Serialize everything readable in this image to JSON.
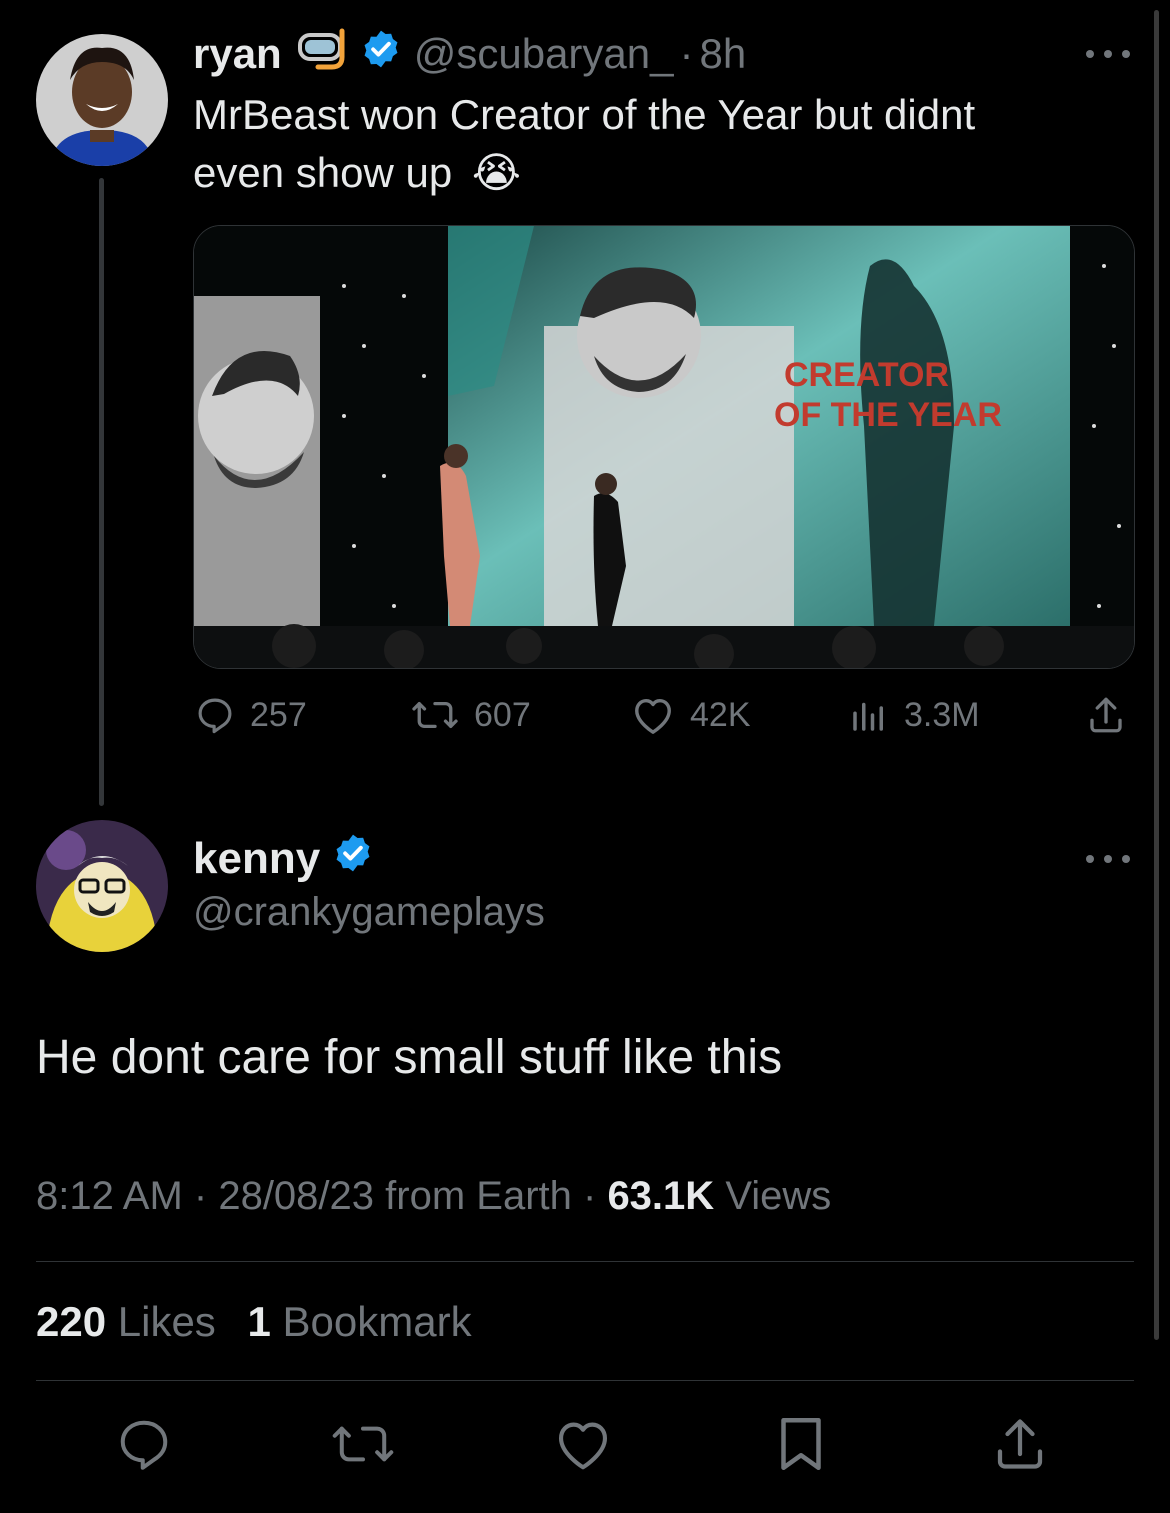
{
  "parent_tweet": {
    "display_name": "ryan",
    "handle": "@scubaryan_",
    "separator": "·",
    "time_ago": "8h",
    "text_line1": "MrBeast won Creator of the Year but didnt",
    "text_line2": "even show up",
    "emoji": "😭",
    "media": {
      "overlay_line1": "CREATOR",
      "overlay_line2": "OF THE YEAR"
    },
    "actions": {
      "replies": "257",
      "retweets": "607",
      "likes": "42K",
      "views": "3.3M"
    }
  },
  "main_tweet": {
    "display_name": "kenny",
    "handle": "@crankygameplays",
    "text": "He dont care for small stuff like this",
    "meta": {
      "time": "8:12 AM",
      "date": "28/08/23",
      "source": "from Earth",
      "views_count": "63.1K",
      "views_label": "Views"
    },
    "stats": {
      "likes_count": "220",
      "likes_label": "Likes",
      "bookmarks_count": "1",
      "bookmarks_label": "Bookmark"
    }
  },
  "colors": {
    "background": "#000000",
    "text": "#e7e9ea",
    "muted": "#71767b",
    "verified": "#1d9bf0",
    "divider": "#2f3336"
  },
  "icons": [
    "reply-icon",
    "retweet-icon",
    "like-icon",
    "views-icon",
    "share-icon",
    "bookmark-icon",
    "more-icon",
    "verified-icon",
    "snorkel-icon"
  ]
}
